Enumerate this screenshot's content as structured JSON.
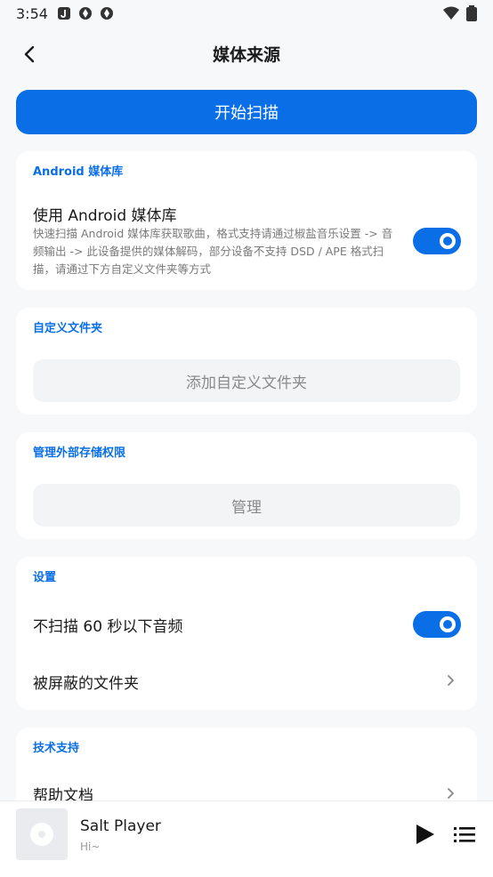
{
  "status_bar": {
    "time": "3:54"
  },
  "header": {
    "title": "媒体来源"
  },
  "scan_button": {
    "label": "开始扫描"
  },
  "android_library": {
    "section_title": "Android 媒体库",
    "option_title": "使用 Android 媒体库",
    "option_desc": "快速扫描 Android 媒体库获取歌曲，格式支持请通过椒盐音乐设置 -> 音频输出 -> 此设备提供的媒体解码，部分设备不支持 DSD / APE 格式扫描，请通过下方自定义文件夹等方式",
    "enabled": true
  },
  "custom_folder": {
    "section_title": "自定义文件夹",
    "button_label": "添加自定义文件夹"
  },
  "external_storage": {
    "section_title": "管理外部存储权限",
    "button_label": "管理"
  },
  "settings": {
    "section_title": "设置",
    "skip_short_label": "不扫描 60 秒以下音频",
    "skip_short_enabled": true,
    "blocked_folders_label": "被屏蔽的文件夹"
  },
  "tech_support": {
    "section_title": "技术支持",
    "help_docs_label": "帮助文档"
  },
  "player": {
    "title": "Salt Player",
    "subtitle": "Hi~"
  },
  "colors": {
    "accent": "#0a6fe6",
    "background": "#f7f8fa"
  }
}
